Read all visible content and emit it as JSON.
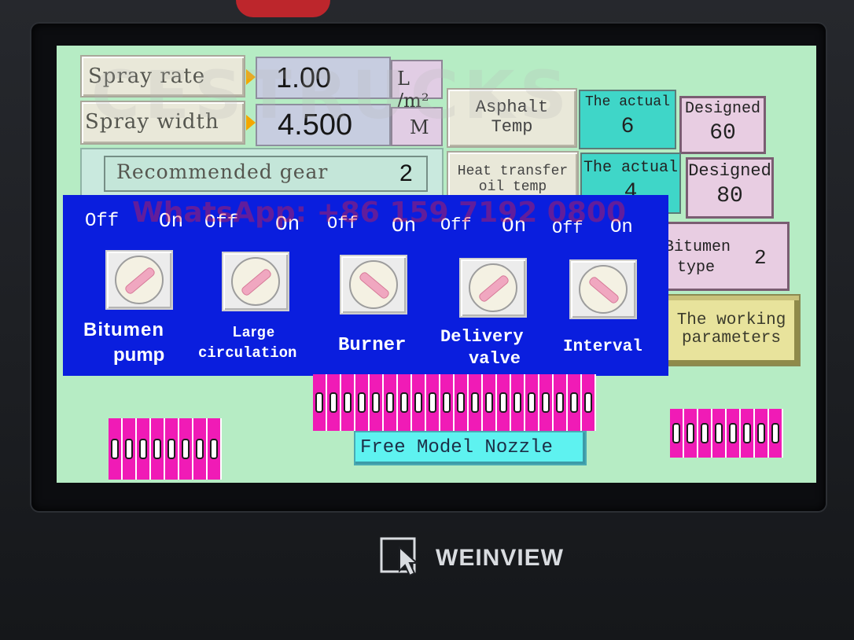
{
  "brand": {
    "name": "WEINVIEW",
    "logo_icon": "weinview-cursor-icon"
  },
  "watermarks": {
    "top": "CESTRUCKS",
    "middle": "WhatsApp: +86 159 7192 0800"
  },
  "spray_rate": {
    "label": "Spray rate",
    "value": "1.00",
    "unit": "L /m²"
  },
  "spray_width": {
    "label": "Spray width",
    "value": "4.500",
    "unit": "M"
  },
  "recommended_gear": {
    "label": "Recommended gear",
    "value": "2"
  },
  "asphalt_temp": {
    "label_line1": "Asphalt",
    "label_line2": "Temp",
    "actual_label": "The actual",
    "actual_value": "6",
    "designed_label": "Designed",
    "designed_value": "60"
  },
  "oil_temp": {
    "label_line1": "Heat transfer",
    "label_line2": "oil temp",
    "actual_label": "The actual",
    "actual_value": "4",
    "designed_label": "Designed",
    "designed_value": "80"
  },
  "bitumen_type": {
    "label_line1": "Bitumen",
    "label_line2": "type",
    "value": "2"
  },
  "working_parameters": {
    "line1": "The working",
    "line2": "parameters"
  },
  "switches": [
    {
      "off": "Off",
      "on": "On",
      "line1": "Bitumen",
      "line2": "pump"
    },
    {
      "off": "Off",
      "on": "On",
      "line1": "Large",
      "line2": "circulation"
    },
    {
      "off": "Off",
      "on": "On",
      "line1": "Burner",
      "line2": ""
    },
    {
      "off": "Off",
      "on": "On",
      "line1": "Delivery",
      "line2": "valve"
    },
    {
      "off": "Off",
      "on": "On",
      "line1": "Interval",
      "line2": ""
    }
  ],
  "nozzles": {
    "left_count": 8,
    "center_count": 20,
    "right_count": 8
  },
  "free_model_nozzle": "Free Model Nozzle",
  "colors": {
    "screen_bg": "#b6ecc4",
    "panel_blue": "#0a1ede",
    "nozzle_pink": "#f01bb6",
    "actual_cyan": "#3fd6c8",
    "designed_pink": "#e8cde2",
    "switch_arrow": "#f3a700"
  }
}
